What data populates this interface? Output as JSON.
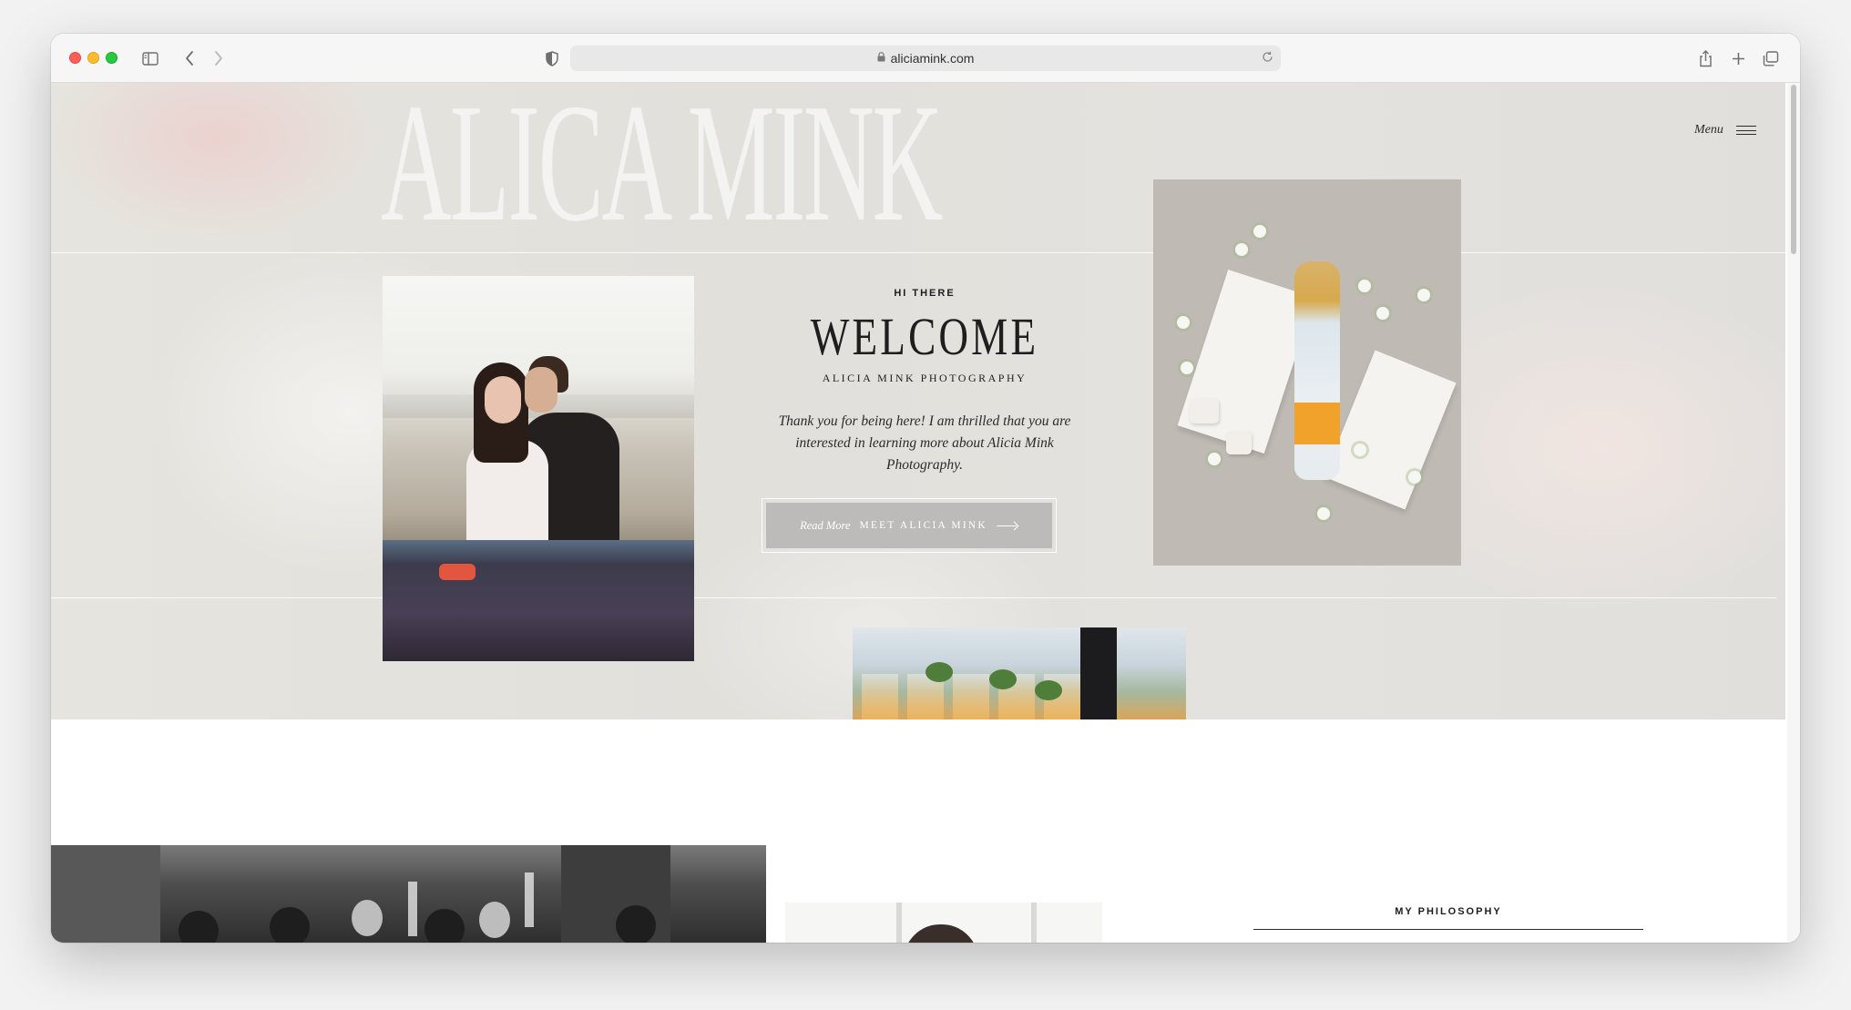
{
  "browser": {
    "url": "aliciamink.com",
    "icons": {
      "sidebar": "sidebar-icon",
      "back": "chevron-left-icon",
      "forward": "chevron-right-icon",
      "privacy": "shield-icon",
      "lock": "lock-icon",
      "reload": "reload-icon",
      "share": "share-icon",
      "new_tab": "plus-icon",
      "tabs": "tab-overview-icon"
    }
  },
  "site": {
    "brand_watermark": "ALICA MINK",
    "menu_label": "Menu",
    "hero": {
      "kicker": "HI THERE",
      "title": "WELCOME",
      "subtitle": "ALICIA MINK PHOTOGRAPHY",
      "intro": "Thank you for being here! I am thrilled that you are interested in learning more about Alicia Mink Photography.",
      "cta_read": "Read More",
      "cta_label": "MEET ALICIA MINK"
    },
    "philosophy_label": "MY PHILOSOPHY"
  },
  "colors": {
    "hero_background": "#e3e1dc",
    "cta_background": "#bdbbb9",
    "text": "#1e1e1e"
  }
}
